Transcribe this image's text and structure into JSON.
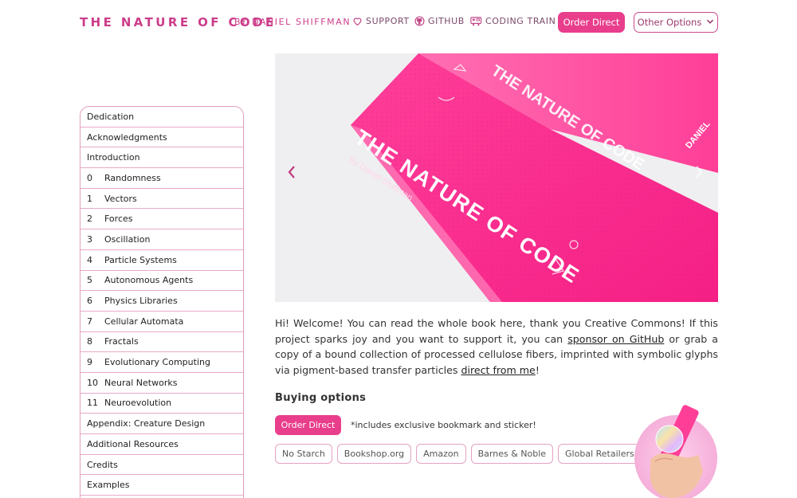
{
  "header": {
    "site_title": "THE NATURE OF CODE",
    "byline": "BY DANIEL SHIFFMAN",
    "nav": {
      "support": {
        "label": "SUPPORT",
        "icon": "heart-icon"
      },
      "github": {
        "label": "GITHUB",
        "icon": "github-icon"
      },
      "coding_train": {
        "label": "CODING TRAIN",
        "icon": "train-icon"
      }
    },
    "order_direct": "Order Direct",
    "other_options": "Other Options"
  },
  "toc": {
    "items": [
      {
        "num": "",
        "label": "Dedication"
      },
      {
        "num": "",
        "label": "Acknowledgments"
      },
      {
        "num": "",
        "label": "Introduction"
      },
      {
        "num": "0",
        "label": "Randomness"
      },
      {
        "num": "1",
        "label": "Vectors"
      },
      {
        "num": "2",
        "label": "Forces"
      },
      {
        "num": "3",
        "label": "Oscillation"
      },
      {
        "num": "4",
        "label": "Particle Systems"
      },
      {
        "num": "5",
        "label": "Autonomous Agents"
      },
      {
        "num": "6",
        "label": "Physics Libraries"
      },
      {
        "num": "7",
        "label": "Cellular Automata"
      },
      {
        "num": "8",
        "label": "Fractals"
      },
      {
        "num": "9",
        "label": "Evolutionary Computing"
      },
      {
        "num": "10",
        "label": "Neural Networks"
      },
      {
        "num": "11",
        "label": "Neuroevolution"
      },
      {
        "num": "",
        "label": "Appendix: Creature Design"
      },
      {
        "num": "",
        "label": "Additional Resources"
      },
      {
        "num": "",
        "label": "Credits"
      },
      {
        "num": "",
        "label": "Examples"
      }
    ]
  },
  "hero": {
    "book_title": "THE NATURE OF CODE",
    "book_author": "By Daniel Shiffman",
    "cover_title": "THE NATURE OF CODE",
    "cover_author": "DANIEL",
    "prev_icon": "chevron-left-icon",
    "next_icon": "chevron-right-icon"
  },
  "intro": {
    "text_1": "Hi! Welcome! You can read the whole book here, thank you Creative Commons! If this project sparks joy and you want to support it, you can ",
    "link_github": "sponsor on GitHub",
    "text_2": " or grab a copy of a bound collection of processed cellulose fibers, imprinted with symbolic glyphs via pigment-based transfer particles ",
    "link_direct": "direct from me",
    "text_3": "!"
  },
  "buying": {
    "title": "Buying options",
    "order_direct": "Order Direct",
    "note": "*includes exclusive bookmark and sticker!",
    "retailers": [
      "No Starch",
      "Bookshop.org",
      "Amazon",
      "Barnes & Noble",
      "Global Retailers"
    ]
  },
  "colors": {
    "accent": "#e83e8c",
    "title_pink": "#cc3d8a",
    "book_pink": "#ff2a8e",
    "border_pink": "#e8a9c8"
  }
}
